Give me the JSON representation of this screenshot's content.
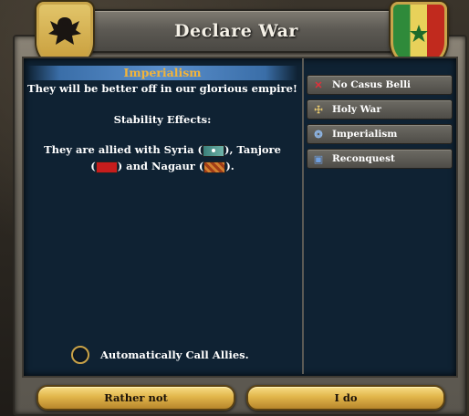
{
  "window": {
    "title": "Declare War"
  },
  "selected_cb": {
    "name": "Imperialism",
    "description": "They will be better off in our glorious empire!",
    "stability_label": "Stability Effects:"
  },
  "allies": {
    "prefix": "They are allied with Syria (",
    "mid1": "), Tanjore",
    "open2": "(",
    "mid2": ") and Nagaur (",
    "suffix": ")."
  },
  "auto_call": {
    "label": "Automatically Call Allies."
  },
  "cb_list": [
    {
      "label": "No Casus Belli",
      "icon": "cross-icon"
    },
    {
      "label": "Holy War",
      "icon": "religion-cross-icon"
    },
    {
      "label": "Imperialism",
      "icon": "globe-icon"
    },
    {
      "label": "Reconquest",
      "icon": "book-icon"
    }
  ],
  "buttons": {
    "reject": "Rather not",
    "accept": "I do"
  },
  "colors": {
    "accent": "#f3b43a",
    "panel": "#0f2233",
    "button": "#e2b64b"
  }
}
